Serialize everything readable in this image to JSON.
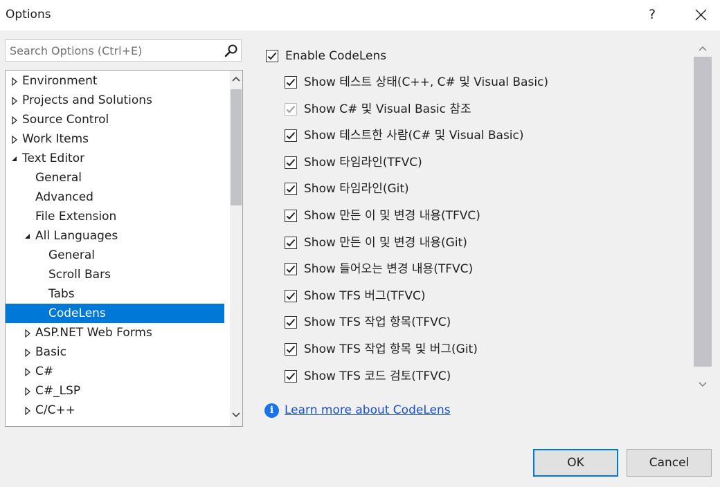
{
  "window": {
    "title": "Options",
    "help_label": "?"
  },
  "search": {
    "placeholder": "Search Options (Ctrl+E)"
  },
  "tree": {
    "items": [
      {
        "label": "Environment",
        "level": 0,
        "state": "collapsed"
      },
      {
        "label": "Projects and Solutions",
        "level": 0,
        "state": "collapsed"
      },
      {
        "label": "Source Control",
        "level": 0,
        "state": "collapsed"
      },
      {
        "label": "Work Items",
        "level": 0,
        "state": "collapsed"
      },
      {
        "label": "Text Editor",
        "level": 0,
        "state": "expanded"
      },
      {
        "label": "General",
        "level": 1,
        "state": "leaf"
      },
      {
        "label": "Advanced",
        "level": 1,
        "state": "leaf"
      },
      {
        "label": "File Extension",
        "level": 1,
        "state": "leaf"
      },
      {
        "label": "All Languages",
        "level": 1,
        "state": "expanded"
      },
      {
        "label": "General",
        "level": 2,
        "state": "leaf"
      },
      {
        "label": "Scroll Bars",
        "level": 2,
        "state": "leaf"
      },
      {
        "label": "Tabs",
        "level": 2,
        "state": "leaf"
      },
      {
        "label": "CodeLens",
        "level": 2,
        "state": "leaf",
        "selected": true
      },
      {
        "label": "ASP.NET Web Forms",
        "level": 1,
        "state": "collapsed"
      },
      {
        "label": "Basic",
        "level": 1,
        "state": "collapsed"
      },
      {
        "label": "C#",
        "level": 1,
        "state": "collapsed"
      },
      {
        "label": "C#_LSP",
        "level": 1,
        "state": "collapsed"
      },
      {
        "label": "C/C++",
        "level": 1,
        "state": "collapsed"
      }
    ]
  },
  "codelens": {
    "enable_label": "Enable CodeLens",
    "options": [
      {
        "label": "Show 테스트 상태(C++, C# 및 Visual Basic)",
        "checked": true
      },
      {
        "label": "Show C# 및 Visual Basic 참조",
        "checked": true,
        "disabled": true
      },
      {
        "label": "Show 테스트한 사람(C# 및 Visual Basic)",
        "checked": true
      },
      {
        "label": "Show 타임라인(TFVC)",
        "checked": true
      },
      {
        "label": "Show 타임라인(Git)",
        "checked": true
      },
      {
        "label": "Show 만든 이 및 변경 내용(TFVC)",
        "checked": true
      },
      {
        "label": "Show 만든 이 및 변경 내용(Git)",
        "checked": true
      },
      {
        "label": "Show 들어오는 변경 내용(TFVC)",
        "checked": true
      },
      {
        "label": "Show TFS 버그(TFVC)",
        "checked": true
      },
      {
        "label": "Show TFS 작업 항목(TFVC)",
        "checked": true
      },
      {
        "label": "Show TFS 작업 항목 및 버그(Git)",
        "checked": true
      },
      {
        "label": "Show TFS 코드 검토(TFVC)",
        "checked": true
      }
    ],
    "learn_more": "Learn more about CodeLens"
  },
  "buttons": {
    "ok": "OK",
    "cancel": "Cancel"
  },
  "colors": {
    "selection": "#0078d7",
    "link": "#1a4fd1",
    "info": "#1a73e8"
  }
}
